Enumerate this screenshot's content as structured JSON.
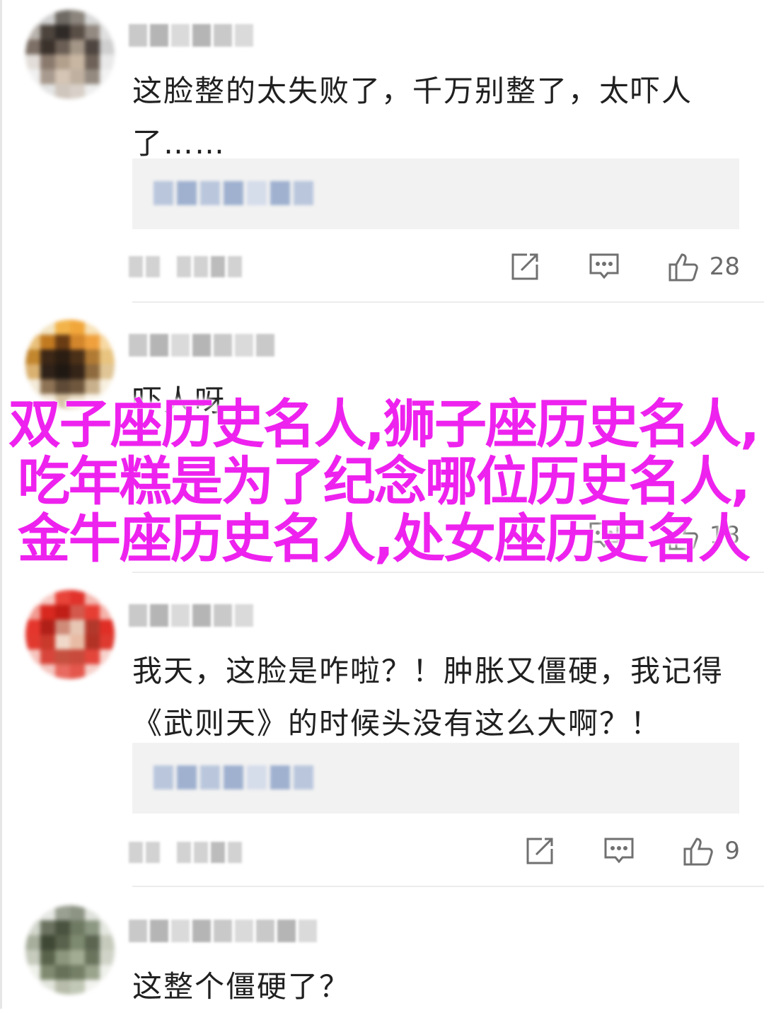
{
  "overlay_title": "双子座历史名人,狮子座历史名人,吃年糕是为了纪念哪位历史名人,金牛座历史名人,处女座历史名人",
  "comments": [
    {
      "text": "这脸整的太失败了，千万别整了，太吓人了……",
      "likes": "28",
      "avatar_colors": [
        "#e8e8e8",
        "#cfcfcf",
        "#6f6a64",
        "#8b857d",
        "#d8d8d8",
        "#eeeeee",
        "#b9b3ad",
        "#4c443d",
        "#2f2a27",
        "#5a4f47",
        "#938a82",
        "#e0e0e0",
        "#7d7066",
        "#3b322c",
        "#6b5f55",
        "#a39687",
        "#4e4540",
        "#cfcfcf",
        "#e2ddd8",
        "#8a7a6e",
        "#b29f8c",
        "#c8b6a2",
        "#6e6258",
        "#e9e9e9",
        "#f0f0f0",
        "#a89a8e",
        "#d4c5b5",
        "#bfb0a0",
        "#948a80",
        "#f2f2f2",
        "#ffffff",
        "#e4e4e4",
        "#cfc6bd",
        "#d8d0c8",
        "#eeeeee",
        "#ffffff"
      ]
    },
    {
      "text": "吓人呀",
      "likes": "18",
      "avatar_colors": [
        "#ffffff",
        "#f3e5c4",
        "#f2b44a",
        "#f1a63a",
        "#f8e2b8",
        "#ffffff",
        "#e9c07a",
        "#c27a21",
        "#6a3c14",
        "#d3862b",
        "#f0a13e",
        "#f7d9a4",
        "#c2862e",
        "#3d2716",
        "#2b1d12",
        "#4b3018",
        "#b07a34",
        "#e8c480",
        "#dab170",
        "#2f2218",
        "#1f1812",
        "#352418",
        "#8e6a3e",
        "#e0c596",
        "#f4ead8",
        "#8e7355",
        "#5e4a36",
        "#6f573e",
        "#c8b08c",
        "#f8f0e0",
        "#ffffff",
        "#f2e8d8",
        "#d4c0a0",
        "#e6d6bc",
        "#faf4ea",
        "#ffffff"
      ]
    },
    {
      "text": "我天，这脸是咋啦？！肿胀又僵硬，我记得《武则天》的时候头没有这么大啊？！",
      "likes": "9",
      "avatar_colors": [
        "#ffffff",
        "#f7c9c3",
        "#e8443a",
        "#e1322b",
        "#f4b8b0",
        "#ffffff",
        "#f29b92",
        "#d8281f",
        "#c01e17",
        "#d4584c",
        "#e73e34",
        "#f5b3ab",
        "#e5362d",
        "#b02018",
        "#cf8a78",
        "#e7c6b4",
        "#b3382c",
        "#e02f26",
        "#e2392f",
        "#c9392c",
        "#f0d8c8",
        "#e8bba4",
        "#b23226",
        "#de3a30",
        "#f6c5be",
        "#d8463b",
        "#c65040",
        "#c84a3c",
        "#e3453b",
        "#f8d3cd",
        "#ffffff",
        "#f4c6c0",
        "#e86a60",
        "#e4574c",
        "#f6cfc9",
        "#ffffff"
      ]
    },
    {
      "text": "这整个僵硬了？",
      "likes": "",
      "avatar_colors": [
        "#ffffff",
        "#e6e8e4",
        "#9aa092",
        "#8d9484",
        "#dfe2dc",
        "#ffffff",
        "#d2d6cc",
        "#6b7360",
        "#4a5340",
        "#6f7a63",
        "#8d9883",
        "#e4e7e0",
        "#a7ae9c",
        "#3f4735",
        "#59624c",
        "#7e8a6f",
        "#5b6550",
        "#c5cabc",
        "#c6cbbd",
        "#59634b",
        "#8c977d",
        "#a2ac93",
        "#6a745d",
        "#d0d4c8",
        "#eef0ea",
        "#7f8a70",
        "#67715a",
        "#747f66",
        "#9aa38c",
        "#eef0ea",
        "#ffffff",
        "#e2e5dc",
        "#b7bdaa",
        "#c2c8b6",
        "#f2f3ef",
        "#ffffff"
      ]
    }
  ]
}
